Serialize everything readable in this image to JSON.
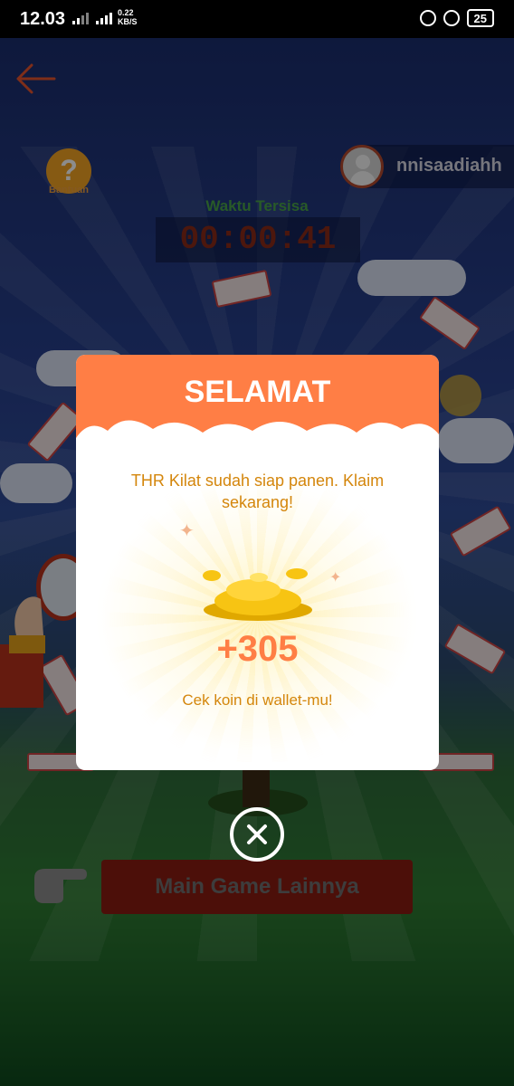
{
  "status_bar": {
    "time": "12.03",
    "network_speed_value": "0.22",
    "network_speed_unit": "KB/S",
    "battery": "25"
  },
  "header": {
    "help_label": "Bantuan",
    "username": "nnisaadiahh"
  },
  "timer": {
    "label": "Waktu Tersisa",
    "value": "00:00:41"
  },
  "background_button": {
    "label": "Main Game Lainnya"
  },
  "modal": {
    "title": "SELAMAT",
    "message": "THR Kilat sudah siap panen. Klaim sekarang!",
    "reward": "+305",
    "note": "Cek koin di wallet-mu!"
  },
  "colors": {
    "accent": "#ff7e45",
    "message_text": "#d4860c",
    "timer_text": "#8a2a18",
    "timer_label": "#4aa54a"
  }
}
